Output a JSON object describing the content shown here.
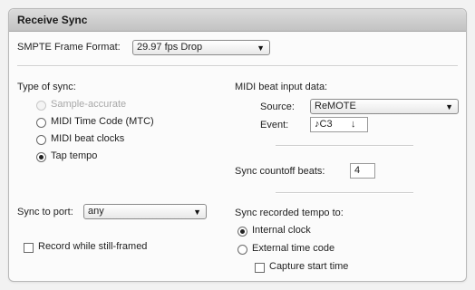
{
  "panel": {
    "title": "Receive Sync"
  },
  "smpte": {
    "label": "SMPTE Frame Format:",
    "value": "29.97 fps Drop"
  },
  "sync_type": {
    "label": "Type of sync:",
    "options": [
      "Sample-accurate",
      "MIDI Time Code (MTC)",
      "MIDI beat clocks",
      "Tap tempo"
    ],
    "selected": "Tap tempo",
    "disabled": [
      "Sample-accurate"
    ]
  },
  "midi_beat": {
    "label": "MIDI beat input data:",
    "source_label": "Source:",
    "source_value": "ReMOTE",
    "event_label": "Event:",
    "event_value": "♪C3",
    "event_arrow": "↓"
  },
  "countoff": {
    "label": "Sync countoff beats:",
    "value": "4"
  },
  "sync_port": {
    "label": "Sync to port:",
    "value": "any"
  },
  "record_still": {
    "label": "Record while still-framed",
    "checked": false
  },
  "sync_tempo": {
    "label": "Sync recorded tempo to:",
    "options": [
      "Internal clock",
      "External time code"
    ],
    "selected": "Internal clock",
    "capture_label": "Capture start time",
    "capture_checked": false
  }
}
